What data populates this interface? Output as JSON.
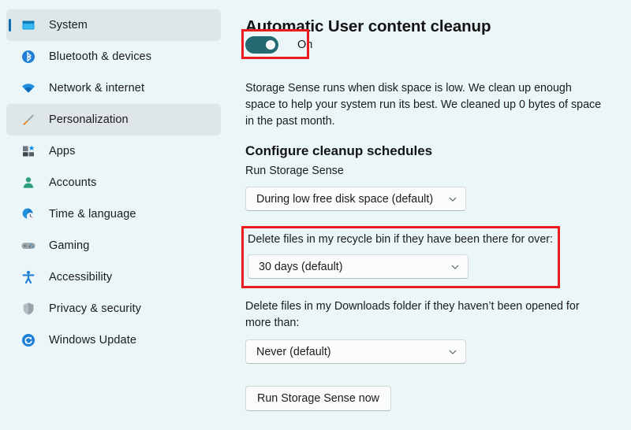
{
  "sidebar": {
    "items": [
      {
        "label": "System",
        "icon": "monitor-icon",
        "state": "selected"
      },
      {
        "label": "Bluetooth & devices",
        "icon": "bluetooth-icon",
        "state": "normal"
      },
      {
        "label": "Network & internet",
        "icon": "wifi-icon",
        "state": "normal"
      },
      {
        "label": "Personalization",
        "icon": "paintbrush-icon",
        "state": "hovered"
      },
      {
        "label": "Apps",
        "icon": "apps-grid-icon",
        "state": "normal"
      },
      {
        "label": "Accounts",
        "icon": "person-icon",
        "state": "normal"
      },
      {
        "label": "Time & language",
        "icon": "clock-globe-icon",
        "state": "normal"
      },
      {
        "label": "Gaming",
        "icon": "gamepad-icon",
        "state": "normal"
      },
      {
        "label": "Accessibility",
        "icon": "accessibility-icon",
        "state": "normal"
      },
      {
        "label": "Privacy & security",
        "icon": "shield-icon",
        "state": "normal"
      },
      {
        "label": "Windows Update",
        "icon": "update-refresh-icon",
        "state": "normal"
      }
    ]
  },
  "main": {
    "title": "Automatic User content cleanup",
    "toggle": {
      "state_label": "On",
      "on_color": "#236a72"
    },
    "description": "Storage Sense runs when disk space is low. We clean up enough space to help your system run its best. We cleaned up 0 bytes of space in the past month.",
    "section_title": "Configure cleanup schedules",
    "fields": {
      "run_storage_sense": {
        "label": "Run Storage Sense",
        "value": "During low free disk space (default)"
      },
      "recycle_bin": {
        "label": "Delete files in my recycle bin if they have been there for over:",
        "value": "30 days (default)"
      },
      "downloads": {
        "label": "Delete files in my Downloads folder if they haven’t been opened for more than:",
        "value": "Never (default)"
      }
    },
    "run_now_button": "Run Storage Sense now",
    "highlight_color": "#ee1c20"
  }
}
